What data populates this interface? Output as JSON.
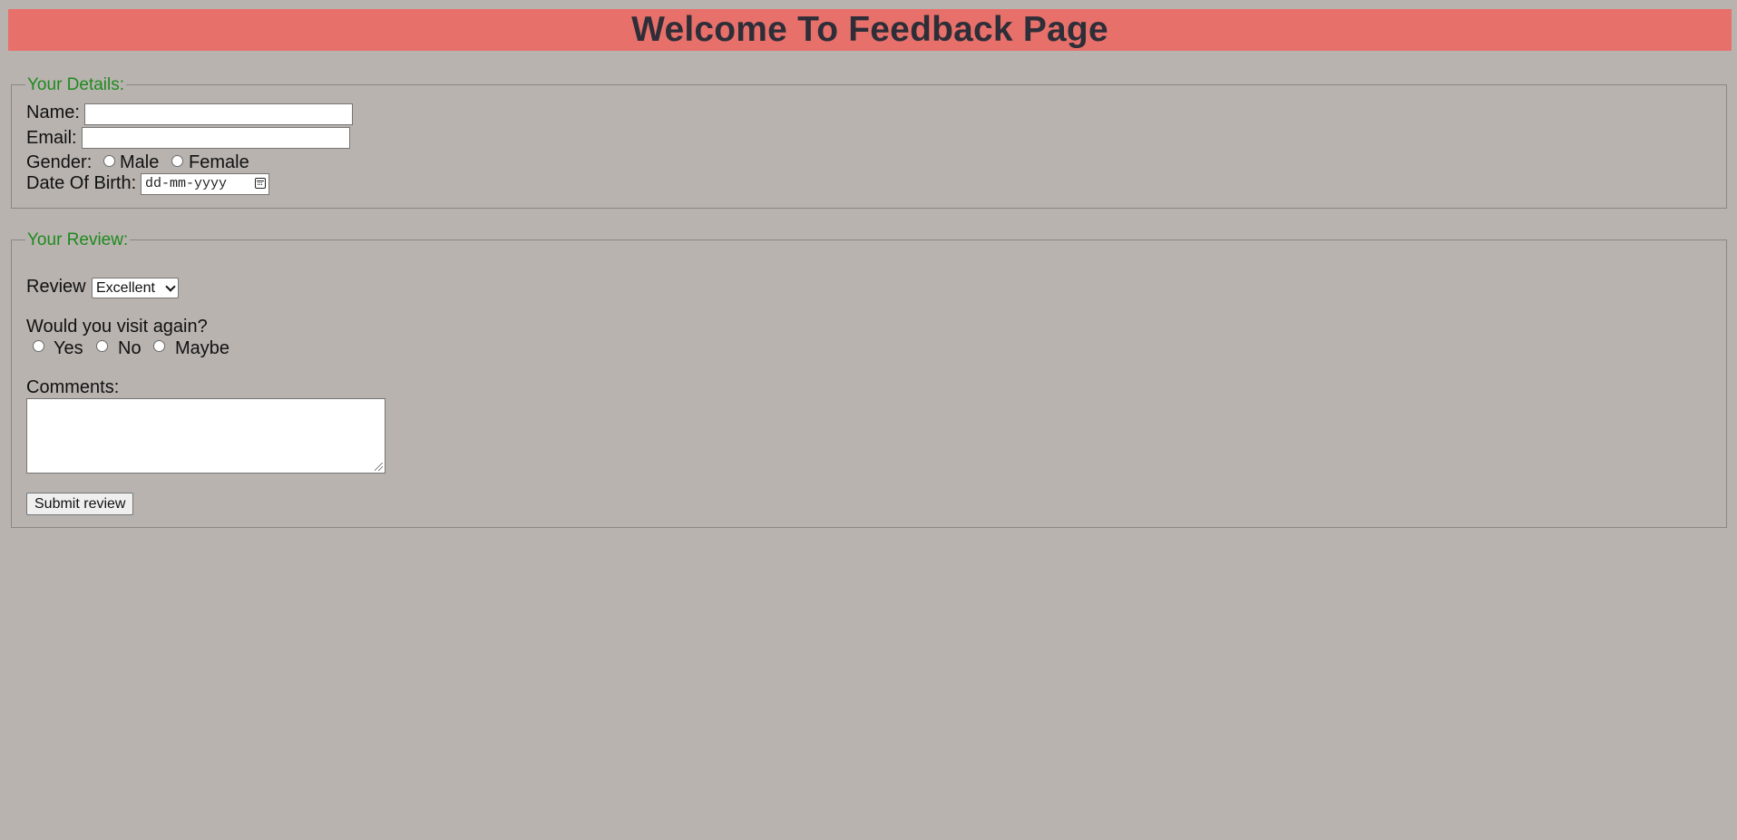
{
  "header": {
    "title": "Welcome To Feedback Page"
  },
  "details": {
    "legend": "Your Details:",
    "name_label": "Name:",
    "name_value": "",
    "email_label": "Email:",
    "email_value": "",
    "gender_label": "Gender:",
    "gender_options": [
      "Male",
      "Female"
    ],
    "dob_label": "Date Of Birth:",
    "dob_placeholder": "dd-mm-yyyy"
  },
  "review": {
    "legend": "Your Review:",
    "review_label": "Review",
    "review_selected": "Excellent",
    "visit_question": "Would you visit again?",
    "visit_options": [
      "Yes",
      "No",
      "Maybe"
    ],
    "comments_label": "Comments:",
    "comments_value": "",
    "submit_label": "Submit review"
  },
  "colors": {
    "background": "#b8b3af",
    "banner": "#e8706a",
    "title_text": "#2e2e38",
    "legend_text": "#1e8a1e"
  }
}
